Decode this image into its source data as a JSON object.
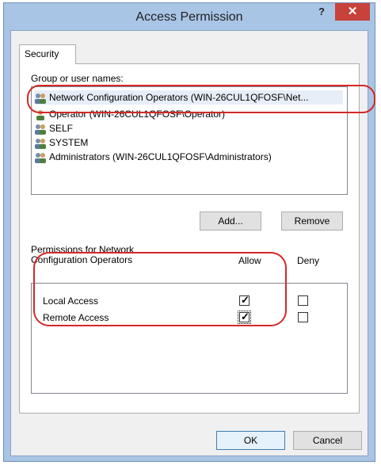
{
  "window": {
    "title": "Access Permission",
    "help_label": "?",
    "close_label": "✕"
  },
  "tabs": [
    {
      "label": "Security"
    }
  ],
  "group_section": {
    "label": "Group or user names:"
  },
  "users": [
    {
      "name": "Network Configuration Operators (WIN-26CUL1QFOSF\\Net...",
      "icon": "group-icon",
      "selected": true
    },
    {
      "name": "Operator (WIN-26CUL1QFOSF\\Operator)",
      "icon": "user-icon",
      "selected": false
    },
    {
      "name": "SELF",
      "icon": "group-icon",
      "selected": false
    },
    {
      "name": "SYSTEM",
      "icon": "group-icon",
      "selected": false
    },
    {
      "name": "Administrators (WIN-26CUL1QFOSF\\Administrators)",
      "icon": "group-icon",
      "selected": false
    }
  ],
  "buttons": {
    "add": "Add...",
    "remove": "Remove",
    "ok": "OK",
    "cancel": "Cancel"
  },
  "permissions": {
    "label_line1": "Permissions for Network",
    "label_line2": "Configuration Operators",
    "allow_header": "Allow",
    "deny_header": "Deny",
    "rows": [
      {
        "name": "Local Access",
        "allow": true,
        "deny": false
      },
      {
        "name": "Remote Access",
        "allow": true,
        "deny": false
      }
    ]
  },
  "colors": {
    "highlight": "#d42828",
    "close_button": "#c7423a",
    "title_bar": "#a9c5e6"
  }
}
